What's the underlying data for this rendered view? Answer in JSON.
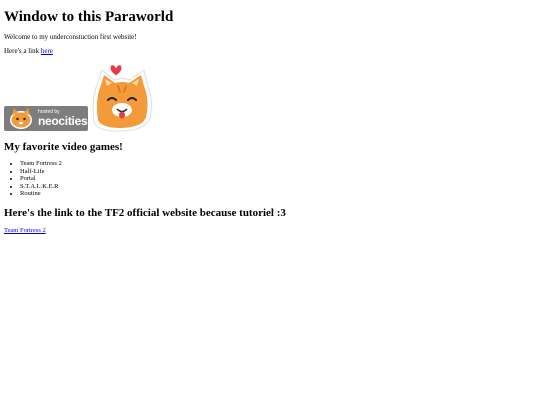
{
  "page": {
    "title": "Window to this Paraworld",
    "welcome": "Welcome to my underconstuction first website!",
    "link_prefix": "Here's a link ",
    "link_text": "here"
  },
  "badge": {
    "hosted_by": "hosted by",
    "brand": "neocities"
  },
  "games": {
    "heading": "My favorite video games!",
    "items": [
      "Team Fortress 2",
      "Half-Life",
      "Portal",
      "S.T.A.L.K.E.R",
      "Routine"
    ]
  },
  "tf2": {
    "heading": "Here's the link to the TF2 official website because tutoriel :3",
    "link_text": "Team Fortress 2"
  },
  "colors": {
    "link": "#0000ee",
    "badge_bg": "#7d7d7d",
    "cat_orange": "#f39a3a",
    "heart": "#e0404a"
  },
  "icons": {
    "cat_sticker": "cat-icon",
    "badge_cat": "cat-icon"
  }
}
